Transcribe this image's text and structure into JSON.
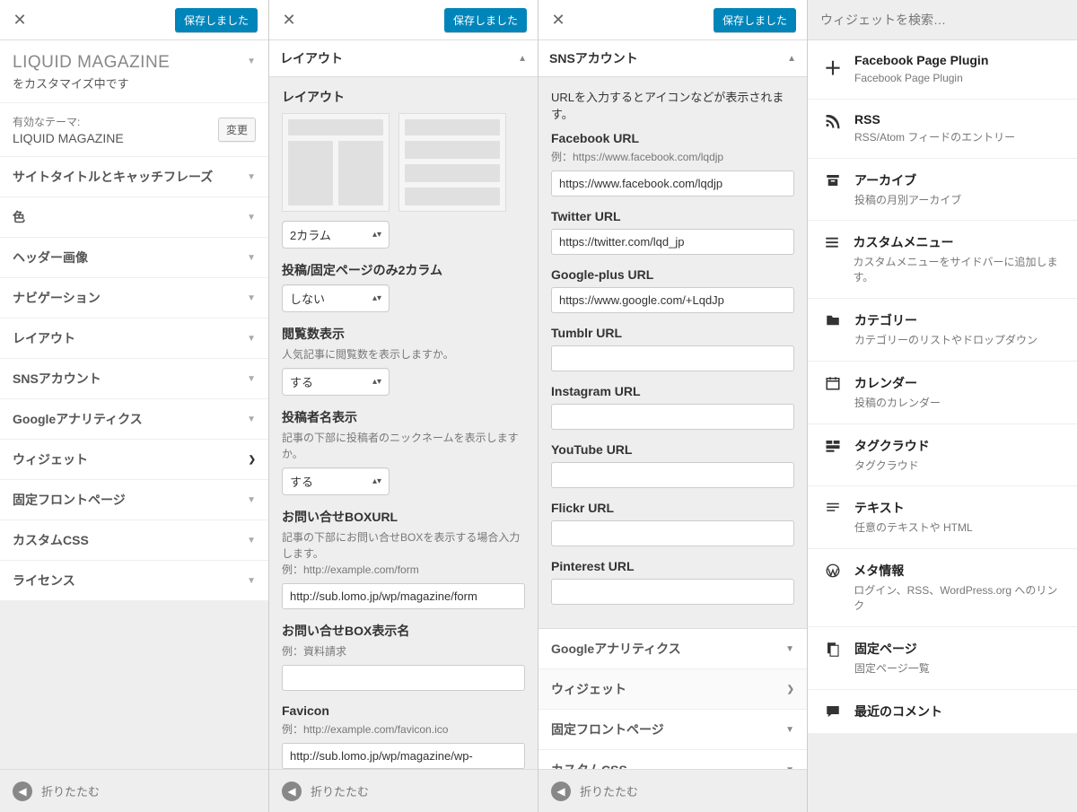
{
  "saved_label": "保存しました",
  "panel1": {
    "title": "LIQUID MAGAZINE",
    "sub": "をカスタマイズ中です",
    "active_theme_label": "有効なテーマ:",
    "active_theme": "LIQUID MAGAZINE",
    "change": "変更",
    "items": [
      "サイトタイトルとキャッチフレーズ",
      "色",
      "ヘッダー画像",
      "ナビゲーション",
      "レイアウト",
      "SNSアカウント",
      "Googleアナリティクス",
      "ウィジェット",
      "固定フロントページ",
      "カスタムCSS",
      "ライセンス"
    ],
    "active_index": 7,
    "collapse": "折りたたむ"
  },
  "panel2": {
    "section": "レイアウト",
    "layout_label": "レイアウト",
    "column_value": "2カラム",
    "post2col_label": "投稿/固定ページのみ2カラム",
    "post2col_value": "しない",
    "views_label": "閲覧数表示",
    "views_desc": "人気記事に閲覧数を表示しますか。",
    "views_value": "する",
    "author_label": "投稿者名表示",
    "author_desc": "記事の下部に投稿者のニックネームを表示しますか。",
    "author_value": "する",
    "contact_url_label": "お問い合せBOXURL",
    "contact_url_desc": "記事の下部にお問い合せBOXを表示する場合入力します。\n例：http://example.com/form",
    "contact_url_value": "http://sub.lomo.jp/wp/magazine/form",
    "contact_name_label": "お問い合せBOX表示名",
    "contact_name_desc": "例：資料請求",
    "contact_name_value": "",
    "favicon_label": "Favicon",
    "favicon_desc": "例：http://example.com/favicon.ico",
    "favicon_value": "http://sub.lomo.jp/wp/magazine/wp-"
  },
  "panel3": {
    "section": "SNSアカウント",
    "desc": "URLを入力するとアイコンなどが表示されます。",
    "fb_label": "Facebook URL",
    "fb_desc": "例：https://www.facebook.com/lqdjp",
    "fb_value": "https://www.facebook.com/lqdjp",
    "tw_label": "Twitter URL",
    "tw_value": "https://twitter.com/lqd_jp",
    "gp_label": "Google-plus URL",
    "gp_value": "https://www.google.com/+LqdJp",
    "tm_label": "Tumblr URL",
    "tm_value": "",
    "ig_label": "Instagram URL",
    "ig_value": "",
    "yt_label": "YouTube URL",
    "yt_value": "",
    "fl_label": "Flickr URL",
    "fl_value": "",
    "pi_label": "Pinterest URL",
    "pi_value": "",
    "sub_items": [
      "Googleアナリティクス",
      "ウィジェット",
      "固定フロントページ",
      "カスタムCSS"
    ],
    "sub_active_index": 1
  },
  "panel4": {
    "search_placeholder": "ウィジェットを検索…",
    "widgets": [
      {
        "icon": "＋",
        "title": "Facebook Page Plugin",
        "desc": "Facebook Page Plugin"
      },
      {
        "icon": "rss",
        "title": "RSS",
        "desc": "RSS/Atom フィードのエントリー"
      },
      {
        "icon": "archive",
        "title": "アーカイブ",
        "desc": "投稿の月別アーカイブ"
      },
      {
        "icon": "menu",
        "title": "カスタムメニュー",
        "desc": "カスタムメニューをサイドバーに追加します。"
      },
      {
        "icon": "folder",
        "title": "カテゴリー",
        "desc": "カテゴリーのリストやドロップダウン"
      },
      {
        "icon": "calendar",
        "title": "カレンダー",
        "desc": "投稿のカレンダー"
      },
      {
        "icon": "tagcloud",
        "title": "タグクラウド",
        "desc": "タグクラウド"
      },
      {
        "icon": "text",
        "title": "テキスト",
        "desc": "任意のテキストや HTML"
      },
      {
        "icon": "wp",
        "title": "メタ情報",
        "desc": "ログイン、RSS、WordPress.org へのリンク"
      },
      {
        "icon": "page",
        "title": "固定ページ",
        "desc": "固定ページ一覧"
      },
      {
        "icon": "comment",
        "title": "最近のコメント",
        "desc": ""
      }
    ]
  }
}
